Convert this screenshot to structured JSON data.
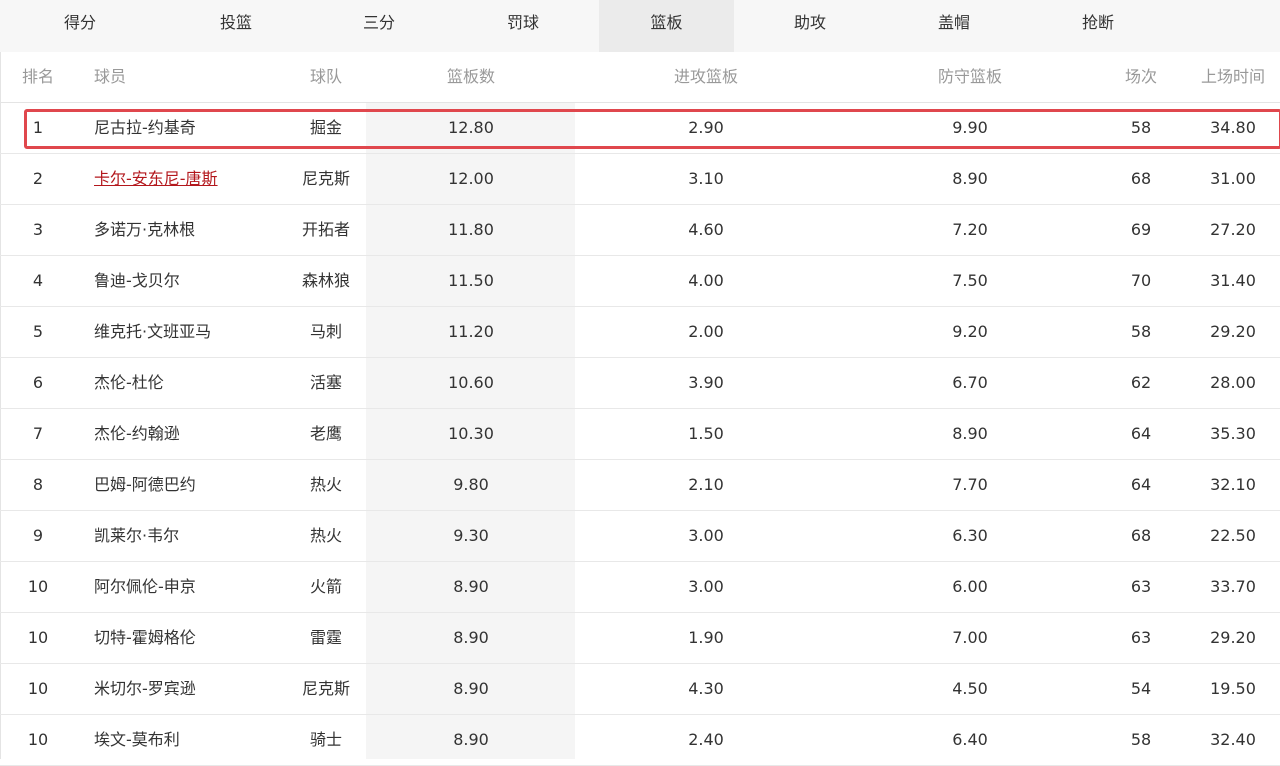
{
  "tabs": [
    {
      "label": "得分",
      "active": false
    },
    {
      "label": "投篮",
      "active": false
    },
    {
      "label": "三分",
      "active": false
    },
    {
      "label": "罚球",
      "active": false
    },
    {
      "label": "篮板",
      "active": true
    },
    {
      "label": "助攻",
      "active": false
    },
    {
      "label": "盖帽",
      "active": false
    },
    {
      "label": "抢断",
      "active": false
    }
  ],
  "columns": {
    "rank": "排名",
    "player": "球员",
    "team": "球队",
    "rebounds": "篮板数",
    "offensive": "进攻篮板",
    "defensive": "防守篮板",
    "games": "场次",
    "minutes": "上场时间"
  },
  "rows": [
    {
      "rank": "1",
      "player": "尼古拉-约基奇",
      "team": "掘金",
      "rebounds": "12.80",
      "offensive": "2.90",
      "defensive": "9.90",
      "games": "58",
      "minutes": "34.80",
      "highlighted": true
    },
    {
      "rank": "2",
      "player": "卡尔-安东尼-唐斯",
      "team": "尼克斯",
      "rebounds": "12.00",
      "offensive": "3.10",
      "defensive": "8.90",
      "games": "68",
      "minutes": "31.00",
      "link": true
    },
    {
      "rank": "3",
      "player": "多诺万·克林根",
      "team": "开拓者",
      "rebounds": "11.80",
      "offensive": "4.60",
      "defensive": "7.20",
      "games": "69",
      "minutes": "27.20"
    },
    {
      "rank": "4",
      "player": "鲁迪-戈贝尔",
      "team": "森林狼",
      "rebounds": "11.50",
      "offensive": "4.00",
      "defensive": "7.50",
      "games": "70",
      "minutes": "31.40"
    },
    {
      "rank": "5",
      "player": "维克托·文班亚马",
      "team": "马刺",
      "rebounds": "11.20",
      "offensive": "2.00",
      "defensive": "9.20",
      "games": "58",
      "minutes": "29.20"
    },
    {
      "rank": "6",
      "player": "杰伦-杜伦",
      "team": "活塞",
      "rebounds": "10.60",
      "offensive": "3.90",
      "defensive": "6.70",
      "games": "62",
      "minutes": "28.00"
    },
    {
      "rank": "7",
      "player": "杰伦-约翰逊",
      "team": "老鹰",
      "rebounds": "10.30",
      "offensive": "1.50",
      "defensive": "8.90",
      "games": "64",
      "minutes": "35.30"
    },
    {
      "rank": "8",
      "player": "巴姆-阿德巴约",
      "team": "热火",
      "rebounds": "9.80",
      "offensive": "2.10",
      "defensive": "7.70",
      "games": "64",
      "minutes": "32.10"
    },
    {
      "rank": "9",
      "player": "凯莱尔·韦尔",
      "team": "热火",
      "rebounds": "9.30",
      "offensive": "3.00",
      "defensive": "6.30",
      "games": "68",
      "minutes": "22.50"
    },
    {
      "rank": "10",
      "player": "阿尔佩伦-申京",
      "team": "火箭",
      "rebounds": "8.90",
      "offensive": "3.00",
      "defensive": "6.00",
      "games": "63",
      "minutes": "33.70"
    },
    {
      "rank": "10",
      "player": "切特-霍姆格伦",
      "team": "雷霆",
      "rebounds": "8.90",
      "offensive": "1.90",
      "defensive": "7.00",
      "games": "63",
      "minutes": "29.20"
    },
    {
      "rank": "10",
      "player": "米切尔-罗宾逊",
      "team": "尼克斯",
      "rebounds": "8.90",
      "offensive": "4.30",
      "defensive": "4.50",
      "games": "54",
      "minutes": "19.50"
    },
    {
      "rank": "10",
      "player": "埃文-莫布利",
      "team": "骑士",
      "rebounds": "8.90",
      "offensive": "2.40",
      "defensive": "6.40",
      "games": "58",
      "minutes": "32.40"
    }
  ],
  "colors": {
    "highlight_border": "#e0474d",
    "link": "#b3171c",
    "active_tab": "#ebebeb"
  }
}
